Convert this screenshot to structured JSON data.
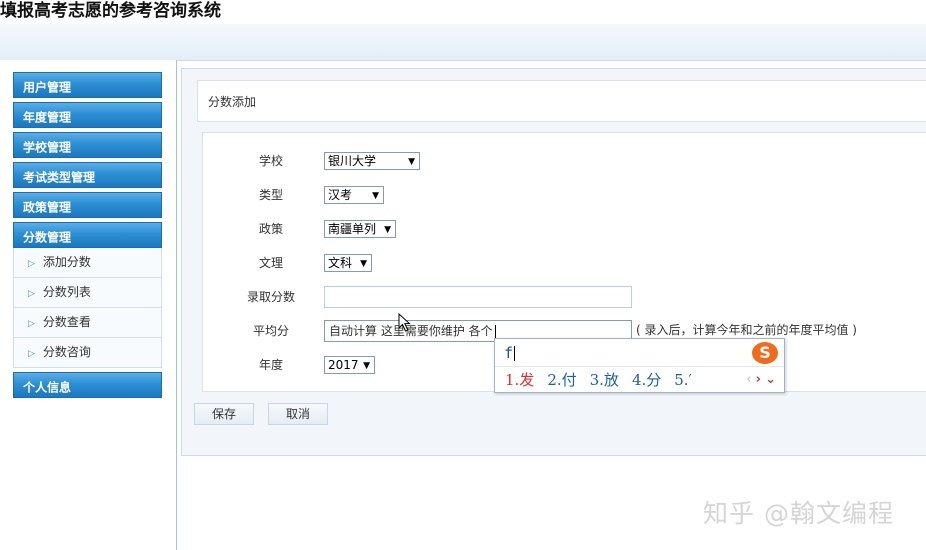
{
  "app": {
    "title": "填报高考志愿的参考咨询系统"
  },
  "sidebar": {
    "menus": [
      {
        "label": "用户管理"
      },
      {
        "label": "年度管理"
      },
      {
        "label": "学校管理"
      },
      {
        "label": "考试类型管理"
      },
      {
        "label": "政策管理"
      },
      {
        "label": "分数管理"
      },
      {
        "label": "个人信息"
      }
    ],
    "score_items": [
      {
        "label": "添加分数"
      },
      {
        "label": "分数列表"
      },
      {
        "label": "分数查看"
      },
      {
        "label": "分数咨询"
      }
    ]
  },
  "page": {
    "title": "分数添加"
  },
  "form": {
    "school": {
      "label": "学校",
      "value": "银川大学"
    },
    "type": {
      "label": "类型",
      "value": "汉考"
    },
    "policy": {
      "label": "政策",
      "value": "南疆单列"
    },
    "subject": {
      "label": "文理",
      "value": "文科"
    },
    "admit_score": {
      "label": "录取分数",
      "value": ""
    },
    "avg_score": {
      "label": "平均分",
      "value": "自动计算 这里需要你维护 各个",
      "hint": "( 录入后，计算今年和之前的年度平均值 )"
    },
    "year": {
      "label": "年度",
      "value": "2017"
    },
    "save_label": "保存",
    "cancel_label": "取消"
  },
  "ime": {
    "composition": "f",
    "candidates": [
      "1.发",
      "2.付",
      "3.放",
      "4.分",
      "5.′"
    ],
    "prev": "‹",
    "next": "›",
    "expand": "⌄",
    "logo": "S"
  },
  "watermark": "知乎 @翰文编程",
  "colors": {
    "menu_blue": "#2d8fd4",
    "ime_red": "#e0302a",
    "ime_blue": "#1b5fb4"
  }
}
